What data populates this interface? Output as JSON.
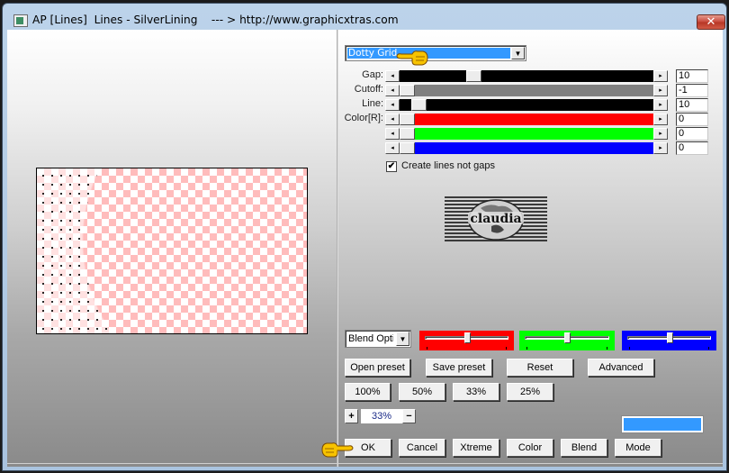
{
  "window": {
    "title": "AP [Lines]  Lines - SilverLining    --- > http://www.graphicxtras.com",
    "close_label": "✕"
  },
  "preset": {
    "selected": "Dotty Grid"
  },
  "sliders": [
    {
      "label": "Gap:",
      "value": "10",
      "track_color": "#000000",
      "position": 0.28
    },
    {
      "label": "Cutoff:",
      "value": "-1",
      "track_color": "#808080",
      "position": 0.0
    },
    {
      "label": "Line:",
      "value": "10",
      "track_color": "#000000",
      "position": 0.05
    },
    {
      "label": "Color[R]:",
      "value": "0",
      "track_color": "#ff0000",
      "position": 0.0
    },
    {
      "label": "",
      "value": "0",
      "track_color": "#00ff00",
      "position": 0.0
    },
    {
      "label": "",
      "value": "0",
      "track_color": "#0000ff",
      "position": 0.0
    }
  ],
  "scroll_left_glyph": "◂",
  "scroll_right_glyph": "▸",
  "checkbox": {
    "label": "Create lines not gaps",
    "checked": true,
    "glyph": "✔"
  },
  "logo": {
    "text": "claudia"
  },
  "blend": {
    "dropdown_value": "Blend Optio",
    "arrow": "▼",
    "color_sliders": [
      {
        "name": "red",
        "color": "#ff0000",
        "position": 0.5
      },
      {
        "name": "green",
        "color": "#00ff00",
        "position": 0.5
      },
      {
        "name": "blue",
        "color": "#0000ff",
        "position": 0.5
      }
    ]
  },
  "buttons": {
    "open_preset": "Open preset",
    "save_preset": "Save preset",
    "reset": "Reset",
    "advanced": "Advanced",
    "zoom_100": "100%",
    "zoom_50": "50%",
    "zoom_33": "33%",
    "zoom_25": "25%",
    "ok": "OK",
    "cancel": "Cancel",
    "xtreme": "Xtreme",
    "color": "Color",
    "blend": "Blend",
    "mode": "Mode"
  },
  "zoom": {
    "plus": "+",
    "value": "33%",
    "minus": "−"
  },
  "swatch_color": "#3399ff"
}
